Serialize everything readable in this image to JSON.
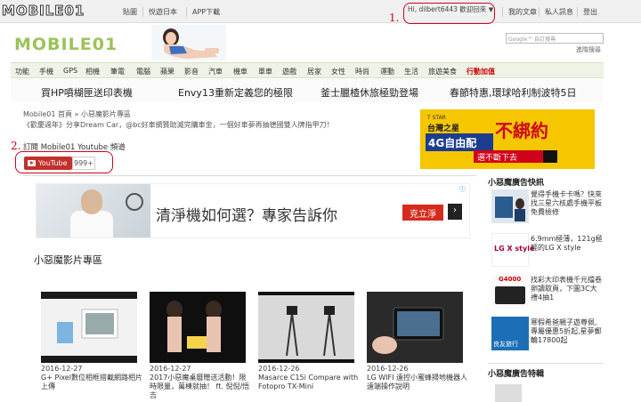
{
  "topbar": {
    "logo": "MOBILE01",
    "links": [
      "貼圖",
      "悅遊日本",
      "APP下載"
    ],
    "greeting": "Hi, dilbert6443 歡迎回來",
    "greeting_arrow": "▼",
    "right_links": [
      "我的文章",
      "私人訊息",
      "登出"
    ]
  },
  "annotation_1": "1.",
  "annotation_2": "2.",
  "banner": {
    "logo": "MOBILE01",
    "search_placeholder": "Google™ 自訂搜尋",
    "advanced_search": "進階搜尋"
  },
  "nav": {
    "items": [
      "功能",
      "手機",
      "GPS",
      "相機",
      "筆電",
      "電腦",
      "蘋果",
      "影音",
      "汽車",
      "機車",
      "單車",
      "遊戲",
      "居家",
      "女性",
      "時尚",
      "運動",
      "生活",
      "旅遊美食",
      "行動加值"
    ]
  },
  "promos": [
    "買HP噴楜匣送印表機",
    "Envy13重新定義您的極限",
    "釜士臘楂休旅極勁登場",
    "春節特惠,環球哈利制波特5日"
  ],
  "breadcrumb": "Mobile01 首頁 » 小惡魔影片專區",
  "marquee": "《歡慶週年》分享Dream Car，@bc好車網贊助滅完購車金，一個好車夢再抽德國雙人牌指甲刀！",
  "subscribe_title": "訂閱 Mobile01 Youtube 頻道",
  "youtube": {
    "label": "YouTube",
    "count": "999+"
  },
  "ad2": {
    "text": "清淨機如何選？專家告訴你",
    "button": "克立淨",
    "arrow": "›",
    "info": "ⓘ"
  },
  "tstar_ad": {
    "brand": "T STAR",
    "line1": "台灣之星",
    "product": "4G自由配",
    "headline": "不綁約",
    "cta": "選不斷下去"
  },
  "video_section": {
    "title": "小惡魔影片專區",
    "videos": [
      {
        "date": "2016-12-27",
        "title": "G+ Pixel數位相框搭載網路相片上傳"
      },
      {
        "date": "2016-12-27",
        "title": "2017小惡魔桌曆贈送活動！限時限量，萬棟就抽！ ft. 倪倪/悟吉"
      },
      {
        "date": "2016-12-26",
        "title": "Masarce C15i Compare with Fotopro TX-Mini"
      },
      {
        "date": "2016-12-26",
        "title": "LG WIFI 遠控小蜜蜂掃地機器人遠端操作說明"
      }
    ]
  },
  "right_column": {
    "quick_title": "小惡魔廣告快訊",
    "ads": [
      {
        "text": "覺得手機卡卡嗎？快來找三星六核處手機平板免費檢修"
      },
      {
        "text": "6.9mm極薄，121g極輕的LG X style",
        "logo": "LG X style"
      },
      {
        "text": "找彩大印表機千元擋卷卵讀取頁，下圖3C大禮4抽1",
        "logo": "G4000"
      },
      {
        "text": "寒假希爸親子遊尊佩,專屬優惠5折起,星夢郵輪17800起",
        "logo": "良友旅行"
      }
    ],
    "special_title": "小惡魔廣告特輯"
  }
}
